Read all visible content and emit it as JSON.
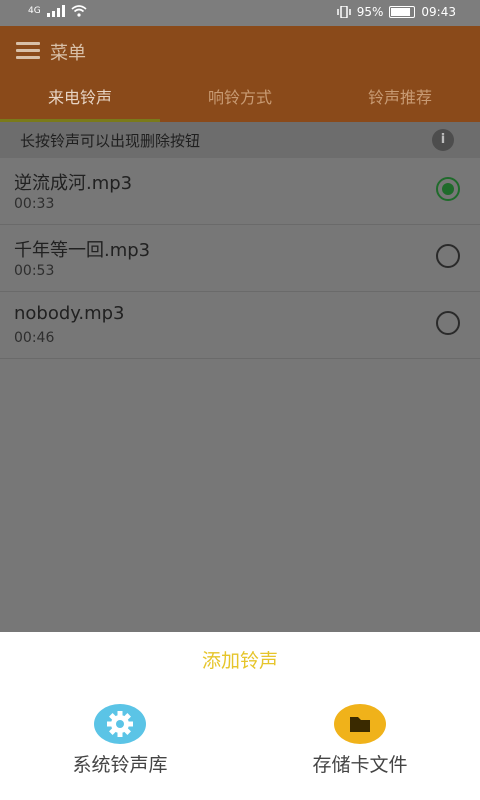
{
  "status": {
    "network": "4G",
    "battery_text": "95%",
    "time": "09:43",
    "battery_level": 0.95
  },
  "appbar": {
    "menu_label": "菜单",
    "tabs": [
      {
        "label": "来电铃声",
        "active": true
      },
      {
        "label": "响铃方式",
        "active": false
      },
      {
        "label": "铃声推荐",
        "active": false
      }
    ]
  },
  "hint": {
    "text": "长按铃声可以出现删除按钮",
    "info_glyph": "i"
  },
  "ringtones": [
    {
      "name": "逆流成河.mp3",
      "duration": "00:33",
      "selected": true
    },
    {
      "name": "千年等一回.mp3",
      "duration": "00:53",
      "selected": false
    },
    {
      "name": "nobody.mp3",
      "duration": "00:46",
      "selected": false
    }
  ],
  "sheet": {
    "title": "添加铃声",
    "options": [
      {
        "label": "系统铃声库",
        "icon": "gear-icon",
        "color": "#5bc4e6"
      },
      {
        "label": "存储卡文件",
        "icon": "folder-icon",
        "color": "#f0b21a"
      }
    ]
  },
  "colors": {
    "accent": "#e6c52b",
    "selected_radio": "#1f6b2b"
  }
}
